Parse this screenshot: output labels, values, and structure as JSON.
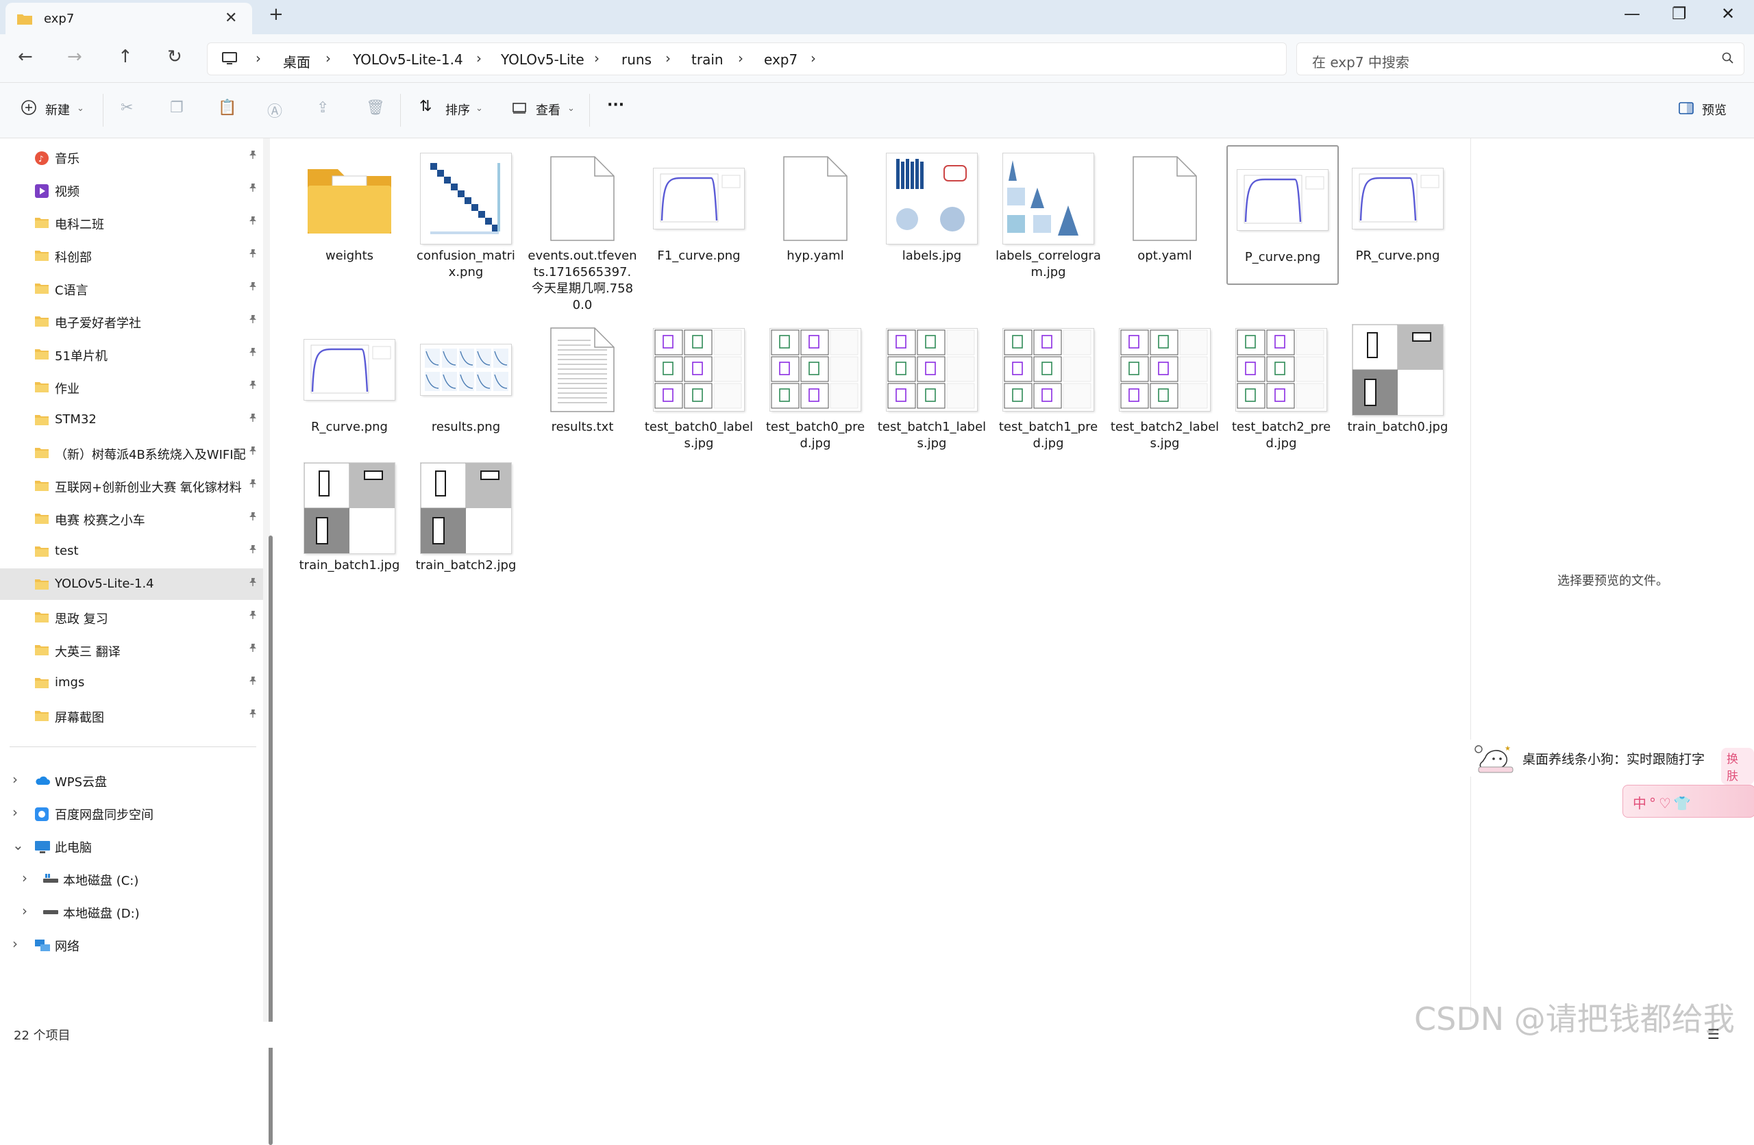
{
  "window": {
    "tab_title": "exp7",
    "tab_close": "✕",
    "new_tab": "+",
    "minimize": "—",
    "maximize": "❐",
    "close": "✕"
  },
  "nav": {
    "back": "←",
    "forward": "→",
    "up": "↑",
    "refresh": "↻",
    "breadcrumbs": [
      "桌面",
      "YOLOv5-Lite-1.4",
      "YOLOv5-Lite",
      "runs",
      "train",
      "exp7"
    ],
    "search_placeholder": "在 exp7 中搜索"
  },
  "commands": {
    "new": "新建",
    "sort": "排序",
    "view": "查看",
    "more": "···",
    "preview": "预览"
  },
  "sidebar": {
    "quick_access": [
      {
        "label": "音乐",
        "icon": "music-icon"
      },
      {
        "label": "视频",
        "icon": "video-icon"
      },
      {
        "label": "电科二班",
        "icon": "folder-icon"
      },
      {
        "label": "科创部",
        "icon": "folder-icon"
      },
      {
        "label": "C语言",
        "icon": "folder-icon"
      },
      {
        "label": "电子爱好者学社",
        "icon": "folder-icon"
      },
      {
        "label": "51单片机",
        "icon": "folder-icon"
      },
      {
        "label": "作业",
        "icon": "folder-icon"
      },
      {
        "label": "STM32",
        "icon": "folder-icon"
      },
      {
        "label": "（新）树莓派4B系统烧入及WIFI配",
        "icon": "folder-icon"
      },
      {
        "label": "互联网+创新创业大赛 氧化镓材料",
        "icon": "folder-icon"
      },
      {
        "label": "电赛 校赛之小车",
        "icon": "folder-icon"
      },
      {
        "label": "test",
        "icon": "folder-icon"
      },
      {
        "label": "YOLOv5-Lite-1.4",
        "icon": "folder-icon"
      },
      {
        "label": "思政 复习",
        "icon": "folder-icon"
      },
      {
        "label": "大英三 翻译",
        "icon": "folder-icon"
      },
      {
        "label": "imgs",
        "icon": "folder-icon"
      },
      {
        "label": "屏幕截图",
        "icon": "folder-icon"
      }
    ],
    "tree": [
      {
        "label": "WPS云盘",
        "icon": "cloud-icon",
        "chevron": "›"
      },
      {
        "label": "百度网盘同步空间",
        "icon": "baidu-netdisk-icon",
        "chevron": "›"
      },
      {
        "label": "此电脑",
        "icon": "computer-icon",
        "chevron": "⌄"
      },
      {
        "label": "本地磁盘 (C:)",
        "icon": "drive-c-icon",
        "chevron": "›"
      },
      {
        "label": "本地磁盘 (D:)",
        "icon": "drive-d-icon",
        "chevron": "›"
      },
      {
        "label": "网络",
        "icon": "network-icon",
        "chevron": "›"
      }
    ],
    "pin": "📌"
  },
  "files": [
    {
      "name": "weights",
      "kind": "folder"
    },
    {
      "name": "confusion_matrix.png",
      "kind": "matrix"
    },
    {
      "name": "events.out.tfevents.1716565397.今天星期几啊.7580.0",
      "kind": "blank"
    },
    {
      "name": "F1_curve.png",
      "kind": "curve"
    },
    {
      "name": "hyp.yaml",
      "kind": "blank"
    },
    {
      "name": "labels.jpg",
      "kind": "labels"
    },
    {
      "name": "labels_correlogram.jpg",
      "kind": "correlogram"
    },
    {
      "name": "opt.yaml",
      "kind": "blank"
    },
    {
      "name": "P_curve.png",
      "kind": "curve"
    },
    {
      "name": "PR_curve.png",
      "kind": "curve"
    },
    {
      "name": "R_curve.png",
      "kind": "curve"
    },
    {
      "name": "results.png",
      "kind": "results"
    },
    {
      "name": "results.txt",
      "kind": "text"
    },
    {
      "name": "test_batch0_labels.jpg",
      "kind": "batch"
    },
    {
      "name": "test_batch0_pred.jpg",
      "kind": "batch"
    },
    {
      "name": "test_batch1_labels.jpg",
      "kind": "batch"
    },
    {
      "name": "test_batch1_pred.jpg",
      "kind": "batch"
    },
    {
      "name": "test_batch2_labels.jpg",
      "kind": "batch"
    },
    {
      "name": "test_batch2_pred.jpg",
      "kind": "batch"
    },
    {
      "name": "train_batch0.jpg",
      "kind": "train"
    },
    {
      "name": "train_batch1.jpg",
      "kind": "train"
    },
    {
      "name": "train_batch2.jpg",
      "kind": "train"
    }
  ],
  "preview": {
    "empty_text": "选择要预览的文件。"
  },
  "ime": {
    "text": "桌面养线条小狗：实时跟随打字",
    "skin": "换肤",
    "pill": "中°♡👕"
  },
  "status": {
    "count": "22 个项目",
    "watermark": "CSDN @请把钱都给我"
  },
  "colors": {
    "folder": "#f2c14e",
    "accent_blue": "#1e4f91",
    "curve_purple": "#5b5bd6"
  }
}
